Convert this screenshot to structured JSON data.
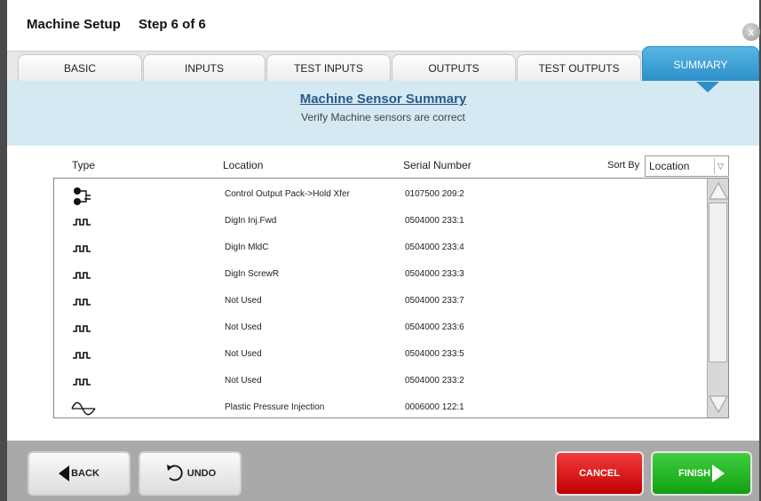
{
  "header": {
    "title": "Machine Setup",
    "step": "Step 6 of 6",
    "close_glyph": "x"
  },
  "tabs": [
    {
      "label": "BASIC",
      "active": false
    },
    {
      "label": "INPUTS",
      "active": false
    },
    {
      "label": "TEST INPUTS",
      "active": false
    },
    {
      "label": "OUTPUTS",
      "active": false
    },
    {
      "label": "TEST OUTPUTS",
      "active": false
    },
    {
      "label": "SUMMARY",
      "active": true
    }
  ],
  "banner": {
    "title": "Machine Sensor Summary",
    "subtitle": "Verify Machine sensors are correct"
  },
  "table": {
    "columns": {
      "type": "Type",
      "location": "Location",
      "serial": "Serial Number"
    },
    "sort_label": "Sort By",
    "sort_value": "Location",
    "rows": [
      {
        "icon": "control-output-icon",
        "location": "Control Output Pack->Hold Xfer",
        "serial": "0107500 209:2"
      },
      {
        "icon": "digital-input-icon",
        "location": "DigIn Inj.Fwd",
        "serial": "0504000 233:1"
      },
      {
        "icon": "digital-input-icon",
        "location": "DigIn MldC",
        "serial": "0504000 233:4"
      },
      {
        "icon": "digital-input-icon",
        "location": "DigIn ScrewR",
        "serial": "0504000 233:3"
      },
      {
        "icon": "digital-input-icon",
        "location": "Not Used",
        "serial": "0504000 233:7"
      },
      {
        "icon": "digital-input-icon",
        "location": "Not Used",
        "serial": "0504000 233:6"
      },
      {
        "icon": "digital-input-icon",
        "location": "Not Used",
        "serial": "0504000 233:5"
      },
      {
        "icon": "digital-input-icon",
        "location": "Not Used",
        "serial": "0504000 233:2"
      },
      {
        "icon": "analog-wave-icon",
        "location": "Plastic Pressure Injection",
        "serial": "0006000 122:1"
      }
    ]
  },
  "footer": {
    "back": "BACK",
    "undo": "UNDO",
    "cancel": "CANCEL",
    "finish": "FINISH"
  },
  "colors": {
    "active_tab": "#2b8fc8",
    "banner_bg": "#d4e9f2",
    "cancel": "#d81515",
    "finish": "#22b422",
    "footer_bg": "#a9a9a9"
  }
}
